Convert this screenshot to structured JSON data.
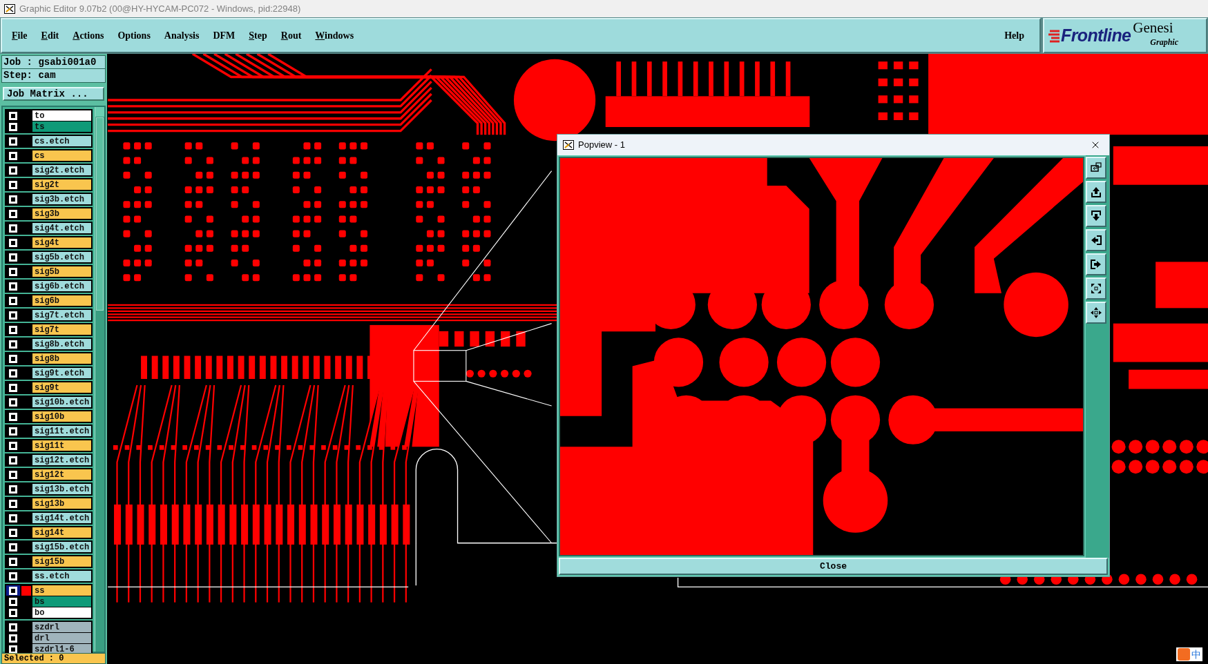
{
  "window": {
    "title": "Graphic Editor 9.07b2 (00@HY-HYCAM-PC072 - Windows, pid:22948)"
  },
  "menu": [
    {
      "label": "File",
      "underline_first": true
    },
    {
      "label": "Edit",
      "underline_first": true
    },
    {
      "label": "Actions",
      "underline_first": true
    },
    {
      "label": "Options",
      "underline_first": false
    },
    {
      "label": "Analysis",
      "underline_first": false
    },
    {
      "label": "DFM",
      "underline_first": false
    },
    {
      "label": "Step",
      "underline_first": true
    },
    {
      "label": "Rout",
      "underline_first": true
    },
    {
      "label": "Windows",
      "underline_first": true
    }
  ],
  "help": "Help",
  "logo": {
    "brand": "Frontline",
    "product": "Genesi",
    "subtitle": "Graphic"
  },
  "job": {
    "job_label": "Job : gsabi001a0",
    "step_label": "Step: cam",
    "matrix_button": "Job Matrix ..."
  },
  "layer_groups": [
    [
      {
        "name": "to",
        "color": "#ffffff",
        "selected": false
      },
      {
        "name": "ts",
        "color": "#0f9a78",
        "selected": false
      }
    ],
    [
      {
        "name": "cs.etch",
        "color": "#a0dcdc",
        "selected": false
      }
    ],
    [
      {
        "name": "cs",
        "color": "#f9c54e",
        "selected": false
      }
    ],
    [
      {
        "name": "sig2t.etch",
        "color": "#a0dcdc",
        "selected": false
      }
    ],
    [
      {
        "name": "sig2t",
        "color": "#f9c54e",
        "selected": false
      }
    ],
    [
      {
        "name": "sig3b.etch",
        "color": "#a0dcdc",
        "selected": false
      }
    ],
    [
      {
        "name": "sig3b",
        "color": "#f9c54e",
        "selected": false
      }
    ],
    [
      {
        "name": "sig4t.etch",
        "color": "#a0dcdc",
        "selected": false
      }
    ],
    [
      {
        "name": "sig4t",
        "color": "#f9c54e",
        "selected": false
      }
    ],
    [
      {
        "name": "sig5b.etch",
        "color": "#a0dcdc",
        "selected": false
      }
    ],
    [
      {
        "name": "sig5b",
        "color": "#f9c54e",
        "selected": false
      }
    ],
    [
      {
        "name": "sig6b.etch",
        "color": "#a0dcdc",
        "selected": false
      }
    ],
    [
      {
        "name": "sig6b",
        "color": "#f9c54e",
        "selected": false
      }
    ],
    [
      {
        "name": "sig7t.etch",
        "color": "#a0dcdc",
        "selected": false
      }
    ],
    [
      {
        "name": "sig7t",
        "color": "#f9c54e",
        "selected": false
      }
    ],
    [
      {
        "name": "sig8b.etch",
        "color": "#a0dcdc",
        "selected": false
      }
    ],
    [
      {
        "name": "sig8b",
        "color": "#f9c54e",
        "selected": false
      }
    ],
    [
      {
        "name": "sig9t.etch",
        "color": "#a0dcdc",
        "selected": false
      }
    ],
    [
      {
        "name": "sig9t",
        "color": "#f9c54e",
        "selected": false
      }
    ],
    [
      {
        "name": "sig10b.etch",
        "color": "#a0dcdc",
        "selected": false
      }
    ],
    [
      {
        "name": "sig10b",
        "color": "#f9c54e",
        "selected": false
      }
    ],
    [
      {
        "name": "sig11t.etch",
        "color": "#a0dcdc",
        "selected": false
      }
    ],
    [
      {
        "name": "sig11t",
        "color": "#f9c54e",
        "selected": false
      }
    ],
    [
      {
        "name": "sig12t.etch",
        "color": "#a0dcdc",
        "selected": false
      }
    ],
    [
      {
        "name": "sig12t",
        "color": "#f9c54e",
        "selected": false
      }
    ],
    [
      {
        "name": "sig13b.etch",
        "color": "#a0dcdc",
        "selected": false
      }
    ],
    [
      {
        "name": "sig13b",
        "color": "#f9c54e",
        "selected": false
      }
    ],
    [
      {
        "name": "sig14t.etch",
        "color": "#a0dcdc",
        "selected": false
      }
    ],
    [
      {
        "name": "sig14t",
        "color": "#f9c54e",
        "selected": false
      }
    ],
    [
      {
        "name": "sig15b.etch",
        "color": "#a0dcdc",
        "selected": false
      }
    ],
    [
      {
        "name": "sig15b",
        "color": "#f9c54e",
        "selected": false
      }
    ],
    [
      {
        "name": "ss.etch",
        "color": "#a0dcdc",
        "selected": false
      }
    ],
    [
      {
        "name": "ss",
        "color": "#f9c54e",
        "selected": true
      },
      {
        "name": "bs",
        "color": "#0f9a78",
        "selected": false
      },
      {
        "name": "bo",
        "color": "#ffffff",
        "selected": false
      }
    ],
    [
      {
        "name": "szdrl",
        "color": "#a0b4bc",
        "selected": false
      },
      {
        "name": "drl",
        "color": "#a0b4bc",
        "selected": false
      },
      {
        "name": "szdrl1-6",
        "color": "#a0b4bc",
        "selected": false
      }
    ]
  ],
  "status": "Selected : 0",
  "popview": {
    "title": "Popview - 1",
    "close_button": "Close"
  },
  "ime": {
    "glyph": "中"
  }
}
